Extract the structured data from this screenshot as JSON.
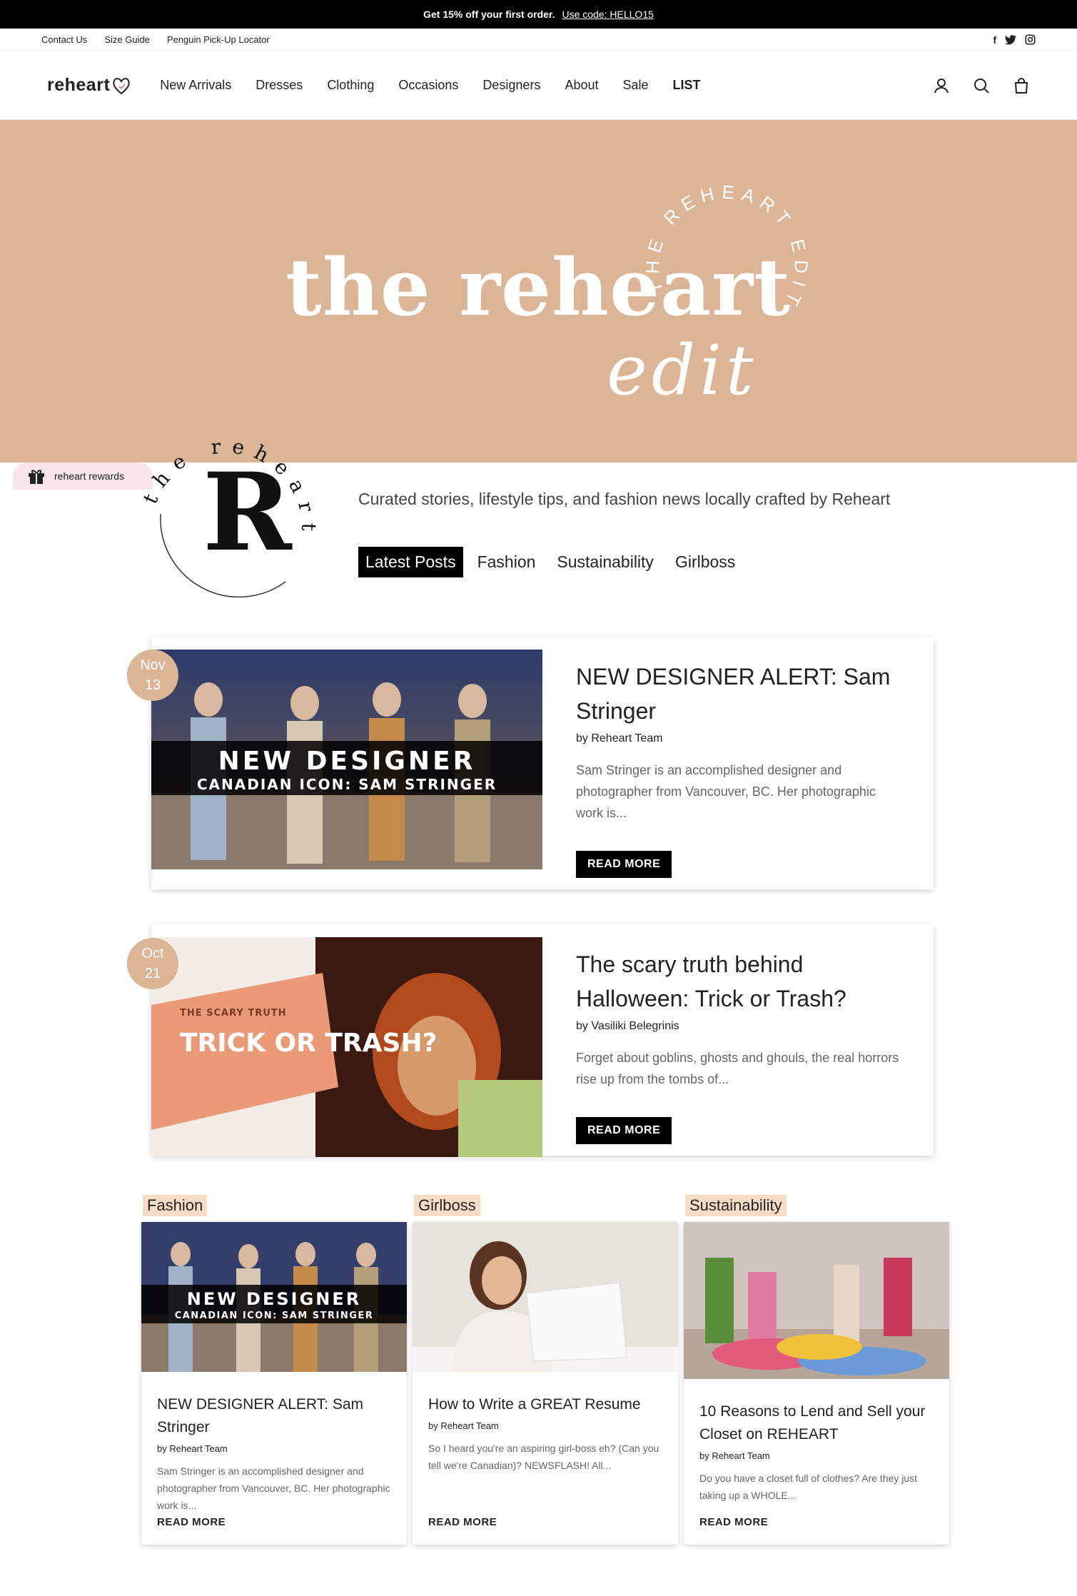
{
  "announcement": {
    "bold": "Get 15% off your first order.",
    "link": "Use code: HELLO15"
  },
  "utility": {
    "links": [
      "Contact Us",
      "Size Guide",
      "Penguin Pick-Up Locator"
    ],
    "social": [
      "facebook-icon",
      "twitter-icon",
      "instagram-icon"
    ]
  },
  "header": {
    "logo": "reheart",
    "nav": [
      "New Arrivals",
      "Dresses",
      "Clothing",
      "Occasions",
      "Designers",
      "About",
      "Sale",
      "LIST"
    ],
    "icons": [
      "account-icon",
      "search-icon",
      "cart-icon"
    ]
  },
  "hero": {
    "title": "the reheart",
    "script": "edit",
    "arc": "THE REHEART EDIT"
  },
  "rewards": {
    "label": "reheart rewards"
  },
  "badge": {
    "letter": "R",
    "arc": "the reheart edit"
  },
  "tagline": "Curated stories, lifestyle tips, and fashion news locally crafted by Reheart",
  "tabs": [
    "Latest Posts",
    "Fashion",
    "Sustainability",
    "Girlboss"
  ],
  "featured": [
    {
      "month": "Nov",
      "day": "13",
      "title": "NEW DESIGNER ALERT: Sam Stringer",
      "author": "by Reheart Team",
      "excerpt": "Sam Stringer is an accomplished designer and photographer from Vancouver, BC. Her photographic work is...",
      "button": "READ MORE",
      "img_line1": "NEW DESIGNER",
      "img_line2": "CANADIAN ICON: SAM STRINGER"
    },
    {
      "month": "Oct",
      "day": "21",
      "title": "The scary truth behind Halloween: Trick or Trash?",
      "author": "by Vasiliki Belegrinis",
      "excerpt": "Forget about goblins, ghosts and ghouls, the real horrors rise up from the tombs of...",
      "button": "READ MORE",
      "img_line1": "THE SCARY TRUTH",
      "img_line2": "TRICK OR TRASH?"
    }
  ],
  "grid": [
    {
      "tag": "Fashion",
      "title": "NEW DESIGNER ALERT: Sam Stringer",
      "author": "by Reheart Team",
      "excerpt": "Sam Stringer is an accomplished designer and photographer from Vancouver, BC. Her photographic work is...",
      "button": "READ MORE",
      "img_line1": "NEW DESIGNER",
      "img_line2": "CANADIAN ICON: SAM STRINGER"
    },
    {
      "tag": "Girlboss",
      "title": "How to Write a GREAT Resume",
      "author": "by Reheart Team",
      "excerpt": "So I heard you're an aspiring girl-boss eh? (Can you tell we're Canadian)? NEWSFLASH! All...",
      "button": "READ MORE"
    },
    {
      "tag": "Sustainability",
      "title": "10 Reasons to Lend and Sell your Closet on REHEART",
      "author": "by Reheart Team",
      "excerpt": "Do you have a closet full of clothes? Are they just taking up a WHOLE...",
      "button": "READ MORE"
    }
  ]
}
